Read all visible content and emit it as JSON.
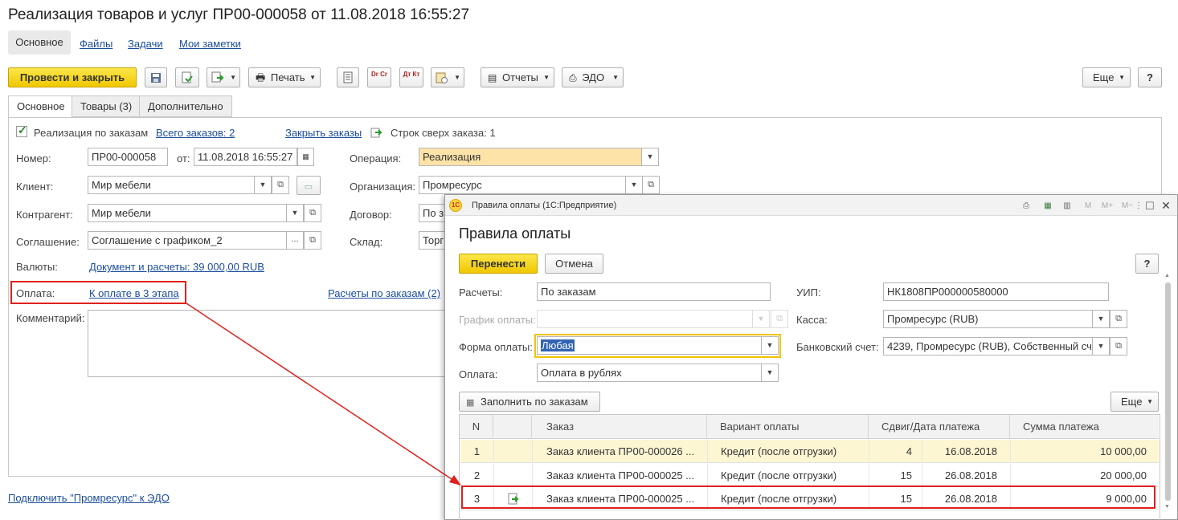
{
  "main": {
    "title": "Реализация товаров и услуг ПР00-000058 от 11.08.2018 16:55:27",
    "nav": [
      "Основное",
      "Файлы",
      "Задачи",
      "Мои заметки"
    ],
    "toolbar": {
      "post_close": "Провести и закрыть",
      "print": "Печать",
      "reports": "Отчеты",
      "edo": "ЭДО",
      "more": "Еще",
      "help": "?",
      "dt_cr": "Dr Cr",
      "dt_kt": "Дт Кт"
    },
    "tabs": [
      "Основное",
      "Товары (3)",
      "Дополнительно"
    ],
    "orders_check_label": "Реализация по заказам",
    "all_orders": "Всего заказов: 2",
    "close_orders": "Закрыть заказы",
    "rows_over_order": "Строк сверх заказа: 1",
    "number_label": "Номер:",
    "number_value": "ПР00-000058",
    "from_label": "от:",
    "date_value": "11.08.2018 16:55:27",
    "operation_label": "Операция:",
    "operation_value": "Реализация",
    "client_label": "Клиент:",
    "client_value": "Мир мебели",
    "org_label": "Организация:",
    "org_value": "Промресурс",
    "counterparty_label": "Контрагент:",
    "counterparty_value": "Мир мебели",
    "contract_label": "Договор:",
    "contract_value": "По з",
    "agreement_label": "Соглашение:",
    "agreement_value": "Соглашение с графиком_2",
    "warehouse_label": "Склад:",
    "warehouse_value": "Торг",
    "currency_label": "Валюты:",
    "currency_link": "Документ и расчеты: 39 000,00 RUB",
    "payment_label": "Оплата:",
    "payment_link": "К оплате в 3 этапа",
    "order_settlements_link": "Расчеты по заказам (2)",
    "comment_label": "Комментарий:",
    "edo_link": "Подключить \"Промресурс\" к ЭДО"
  },
  "dialog": {
    "window_title": "Правила оплаты  (1С:Предприятие)",
    "heading": "Правила оплаты",
    "transfer": "Перенести",
    "cancel": "Отмена",
    "help": "?",
    "settlements_label": "Расчеты:",
    "settlements_value": "По заказам",
    "schedule_label": "График оплаты:",
    "schedule_value": "",
    "form_label": "Форма оплаты:",
    "form_value": "Любая",
    "payment_label": "Оплата:",
    "payment_value": "Оплата в рублях",
    "uip_label": "УИП:",
    "uip_value": "НК1808ПР000000580000",
    "cash_label": "Касса:",
    "cash_value": "Промресурс (RUB)",
    "bank_label": "Банковский счет:",
    "bank_value": "4239, Промресурс (RUB), Собственный сч",
    "fill_button": "Заполнить по заказам",
    "more": "Еще",
    "window_icons": [
      "M",
      "M+",
      "M−"
    ],
    "columns": [
      "N",
      "",
      "Заказ",
      "Вариант оплаты",
      "Сдвиг/Дата платежа",
      "",
      "Сумма платежа"
    ],
    "rows": [
      {
        "n": "1",
        "order": "Заказ клиента ПР00-000026 ...",
        "variant": "Кредит (после отгрузки)",
        "shift": "4",
        "date": "16.08.2018",
        "sum": "10 000,00"
      },
      {
        "n": "2",
        "order": "Заказ клиента ПР00-000025 ...",
        "variant": "Кредит (после отгрузки)",
        "shift": "15",
        "date": "26.08.2018",
        "sum": "20 000,00"
      },
      {
        "n": "3",
        "order": "Заказ клиента ПР00-000025 ...",
        "variant": "Кредит (после отгрузки)",
        "shift": "15",
        "date": "26.08.2018",
        "sum": "9 000,00"
      }
    ]
  },
  "colors": {
    "accent_yellow": "#f5d21a",
    "highlight_red": "#e0201b",
    "selected_row": "#fdf6d3",
    "link_blue": "#1a4d9c"
  }
}
